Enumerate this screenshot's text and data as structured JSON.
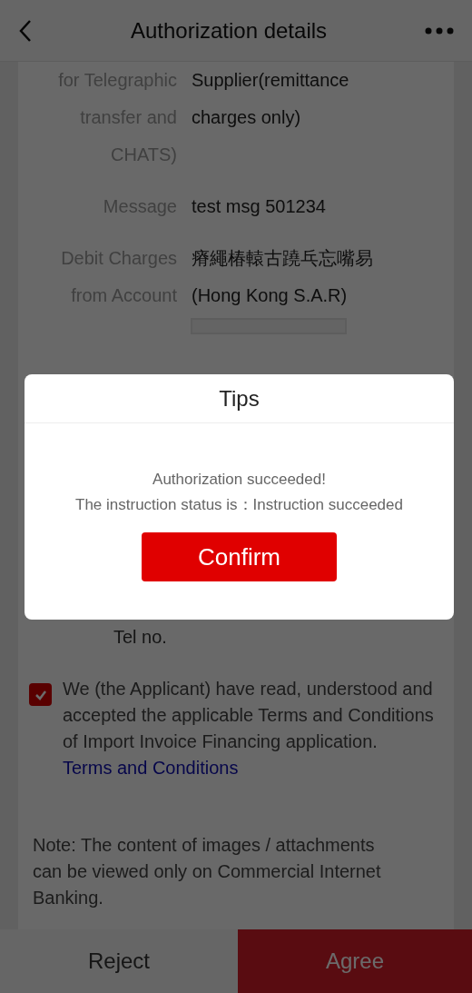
{
  "header": {
    "title": "Authorization details"
  },
  "rows": [
    {
      "label": "for Telegraphic transfer and CHATS)",
      "value": "Supplier(remittance charges only)"
    },
    {
      "label": "Message",
      "value": "test msg 501234"
    },
    {
      "label": "Debit Charges from Account",
      "value": "瘠繩椿轅古蹺乓忘嘴易 (Hong Kong S.A.R)"
    }
  ],
  "tel_label": "Tel no.",
  "agreement": {
    "checked": true,
    "text": "We (the Applicant) have read, understood and accepted the applicable Terms and Conditions of Import Invoice Financing application.",
    "link": "Terms and Conditions"
  },
  "note": "Note: The content of images / attachments can be viewed only on Commercial Internet Banking.",
  "footer": {
    "reject": "Reject",
    "agree": "Agree"
  },
  "dialog": {
    "title": "Tips",
    "lines": [
      "Authorization succeeded!",
      "The instruction status is：Instruction succeeded"
    ],
    "button": "Confirm"
  }
}
